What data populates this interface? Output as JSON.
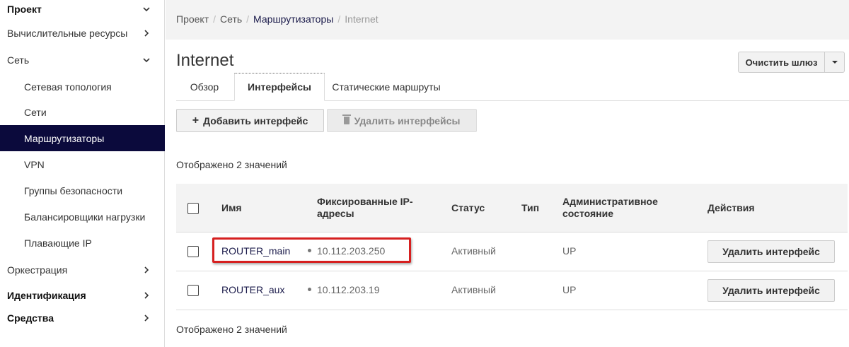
{
  "sidebar": {
    "project": "Проект",
    "compute": "Вычислительные ресурсы",
    "network": "Сеть",
    "items": [
      {
        "label": "Сетевая топология"
      },
      {
        "label": "Сети"
      },
      {
        "label": "Маршрутизаторы",
        "active": true
      },
      {
        "label": "VPN"
      },
      {
        "label": "Группы безопасности"
      },
      {
        "label": "Балансировщики нагрузки"
      },
      {
        "label": "Плавающие IP"
      }
    ],
    "orchestration": "Оркестрация",
    "identity": "Идентификация",
    "tools": "Средства"
  },
  "breadcrumb": {
    "items": [
      "Проект",
      "Сеть",
      "Маршрутизаторы",
      "Internet"
    ]
  },
  "page": {
    "title": "Internet",
    "clear_gateway_label": "Очистить шлюз"
  },
  "tabs": [
    {
      "label": "Обзор"
    },
    {
      "label": "Интерфейсы",
      "active": true
    },
    {
      "label": "Статические маршруты"
    }
  ],
  "actions": {
    "add_label": "Добавить интерфейс",
    "delete_label": "Удалить интерфейсы"
  },
  "count_text": "Отображено 2 значений",
  "table": {
    "columns": {
      "name": "Имя",
      "fixed_ips": "Фиксированные IP-адресы",
      "status": "Статус",
      "type": "Тип",
      "admin_state": "Административное состояние",
      "actions": "Действия"
    },
    "rows": [
      {
        "name": "ROUTER_main",
        "ip": "10.112.203.250",
        "status": "Активный",
        "type": "",
        "admin_state": "UP",
        "action": "Удалить интерфейс"
      },
      {
        "name": "ROUTER_aux",
        "ip": "10.112.203.19",
        "status": "Активный",
        "type": "",
        "admin_state": "UP",
        "action": "Удалить интерфейс"
      }
    ]
  },
  "colors": {
    "sidebar_active_bg": "#0b0a3c",
    "highlight_border": "#d62020"
  }
}
